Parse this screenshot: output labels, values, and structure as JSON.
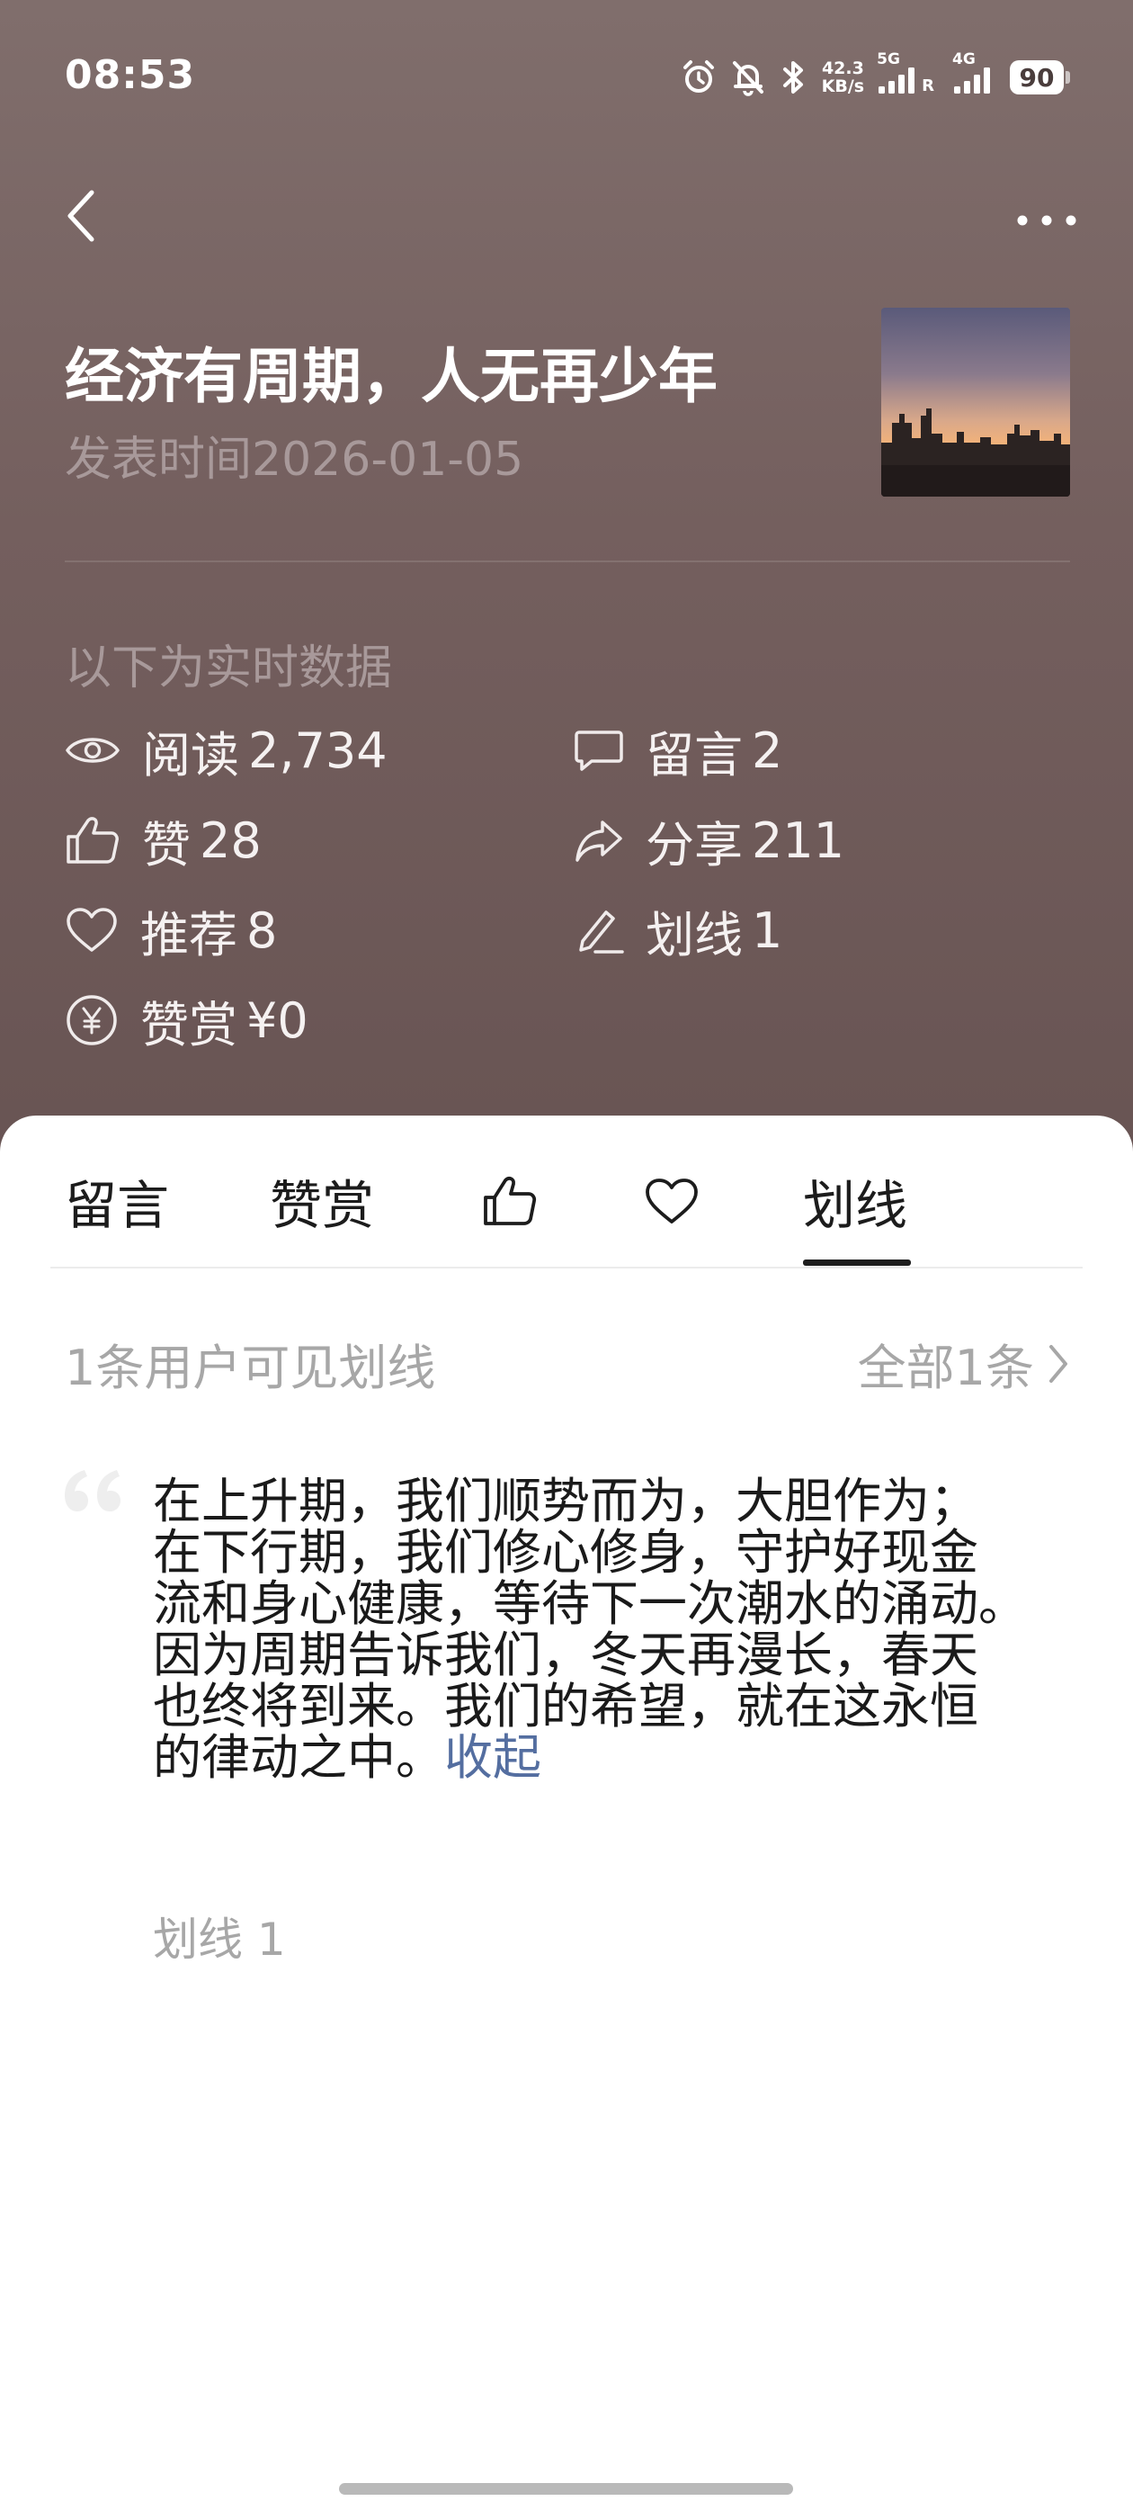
{
  "status_bar": {
    "time": "08:53",
    "net_speed_value": "42.3",
    "net_speed_unit": "KB/s",
    "sim1_label": "5G",
    "sim1_roaming": "R",
    "sim2_label": "4G",
    "battery": "90",
    "icons": [
      "alarm-icon",
      "mute-bell-icon",
      "bluetooth-icon",
      "signal-icon",
      "battery-icon"
    ]
  },
  "top_bar": {
    "back_icon": "chevron-left-icon",
    "more_icon": "more-dots-icon"
  },
  "article": {
    "title": "经济有周期，人无再少年",
    "publish_prefix": "发表时间",
    "publish_date": "2026-01-05",
    "thumbnail": "city-sunset-thumbnail"
  },
  "stats": {
    "section_label": "以下为实时数据",
    "reads": {
      "label": "阅读",
      "value": "2,734",
      "icon": "eye-icon"
    },
    "comments": {
      "label": "留言",
      "value": "2",
      "icon": "comment-icon"
    },
    "likes": {
      "label": "赞",
      "value": "28",
      "icon": "thumbs-up-icon"
    },
    "shares": {
      "label": "分享",
      "value": "211",
      "icon": "share-icon"
    },
    "recommends": {
      "label": "推荐",
      "value": "8",
      "icon": "heart-icon"
    },
    "underlines": {
      "label": "划线",
      "value": "1",
      "icon": "pen-icon"
    },
    "rewards": {
      "label": "赞赏",
      "value": "¥0",
      "icon": "yen-coin-icon"
    }
  },
  "tabs": {
    "comments_label": "留言",
    "rewards_label": "赞赏",
    "like_icon": "thumbs-up-icon",
    "favorite_icon": "heart-icon",
    "underline_label": "划线",
    "active": "划线"
  },
  "underline_panel": {
    "visible_count_text": "1条用户可见划线",
    "all_link_text": "全部1条",
    "quote_lines": [
      "在上升期，我们顺势而为，大胆作为；",
      "在下行期，我们修心修身，守护好现金",
      "流和身心健康，等待下一次潮水的涌动。",
      "因为周期告诉我们，冬天再漫长，春天",
      "也终将到来。我们的希望，就在这永恒",
      "的律动之中。"
    ],
    "collapse_text": "收起",
    "underline_count_text": "划线 1"
  },
  "colors": {
    "header_bg": "#745f5e",
    "muted_header_text": "#a8999a",
    "link_blue": "#546ea0",
    "muted_gray": "#a7a7a7"
  }
}
